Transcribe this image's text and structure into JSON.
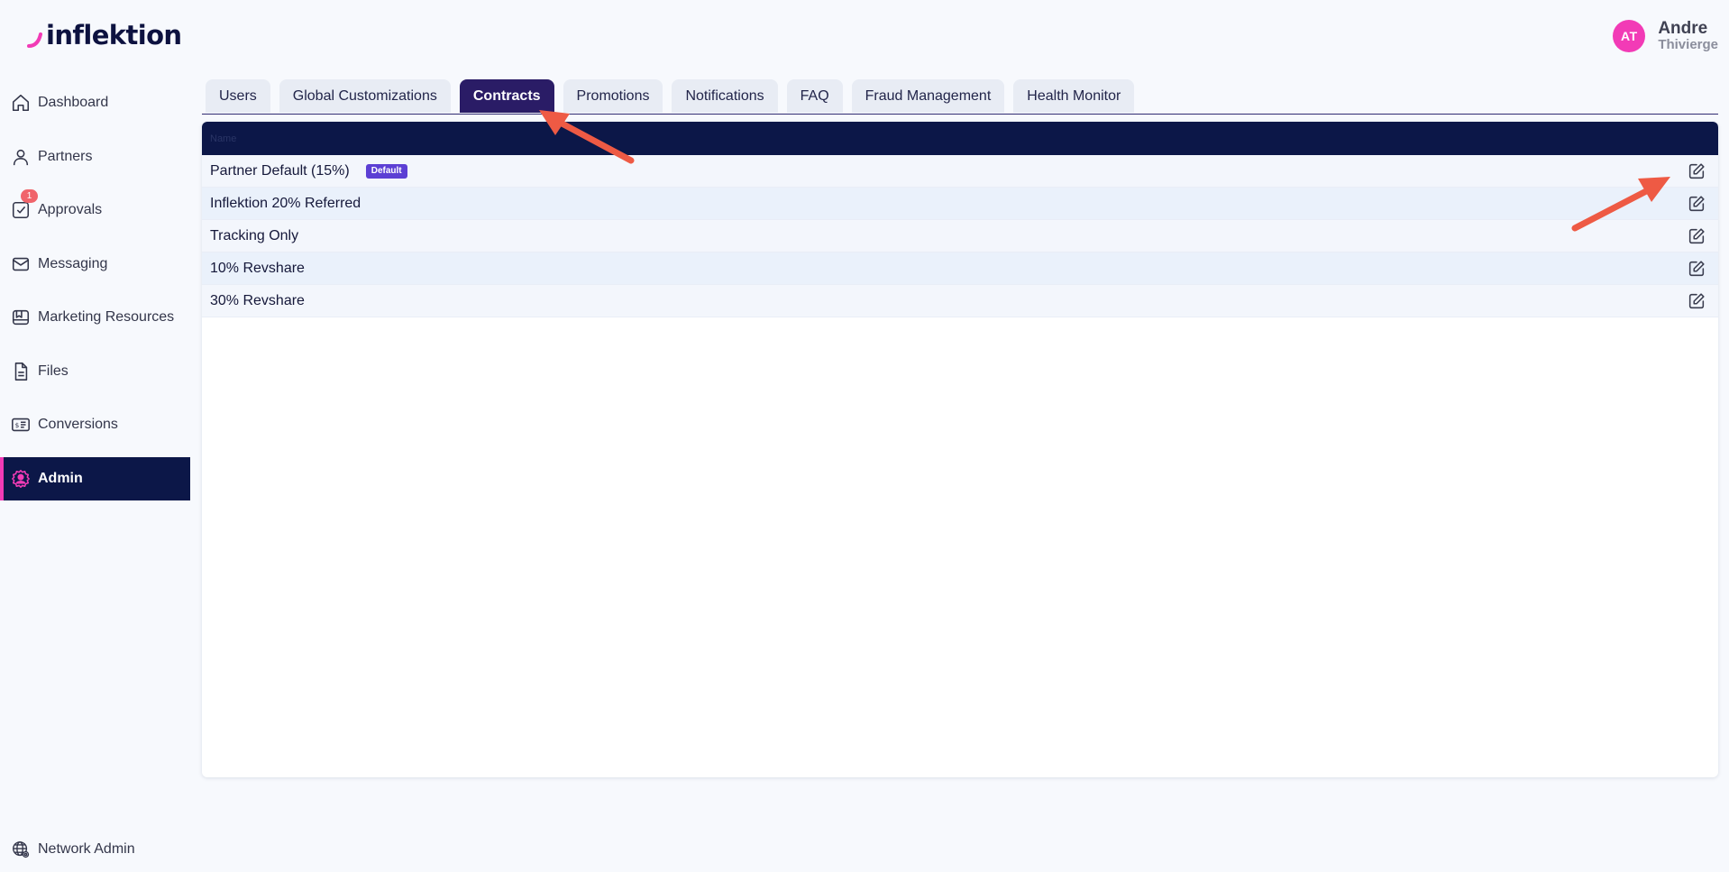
{
  "brand": {
    "name": "inflektion"
  },
  "user": {
    "initials": "AT",
    "first_name": "Andre",
    "last_name": "Thivierge"
  },
  "sidebar": {
    "items": [
      {
        "label": "Dashboard",
        "icon": "home-icon"
      },
      {
        "label": "Partners",
        "icon": "person-icon"
      },
      {
        "label": "Approvals",
        "icon": "check-square-icon",
        "badge": "1"
      },
      {
        "label": "Messaging",
        "icon": "envelope-icon"
      },
      {
        "label": "Marketing Resources",
        "icon": "resources-icon"
      },
      {
        "label": "Files",
        "icon": "file-icon"
      },
      {
        "label": "Conversions",
        "icon": "dollar-list-icon"
      },
      {
        "label": "Admin",
        "icon": "admin-icon",
        "active": true
      }
    ],
    "bottom": {
      "label": "Network Admin",
      "icon": "globe-icon"
    }
  },
  "tabs": [
    {
      "label": "Users"
    },
    {
      "label": "Global Customizations"
    },
    {
      "label": "Contracts",
      "active": true
    },
    {
      "label": "Promotions"
    },
    {
      "label": "Notifications"
    },
    {
      "label": "FAQ"
    },
    {
      "label": "Fraud Management"
    },
    {
      "label": "Health Monitor"
    }
  ],
  "contracts": {
    "header": "Name",
    "default_badge": "Default",
    "rows": [
      {
        "name": "Partner Default (15%)",
        "is_default": true
      },
      {
        "name": "Inflektion 20% Referred"
      },
      {
        "name": "Tracking Only"
      },
      {
        "name": "10% Revshare"
      },
      {
        "name": "30% Revshare"
      }
    ]
  },
  "colors": {
    "brand_pink": "#f23bb6",
    "nav_dark": "#0c1748",
    "active_tab": "#2a1c66",
    "default_badge": "#5c3fd4",
    "annotation_arrow": "#ee5a44"
  }
}
